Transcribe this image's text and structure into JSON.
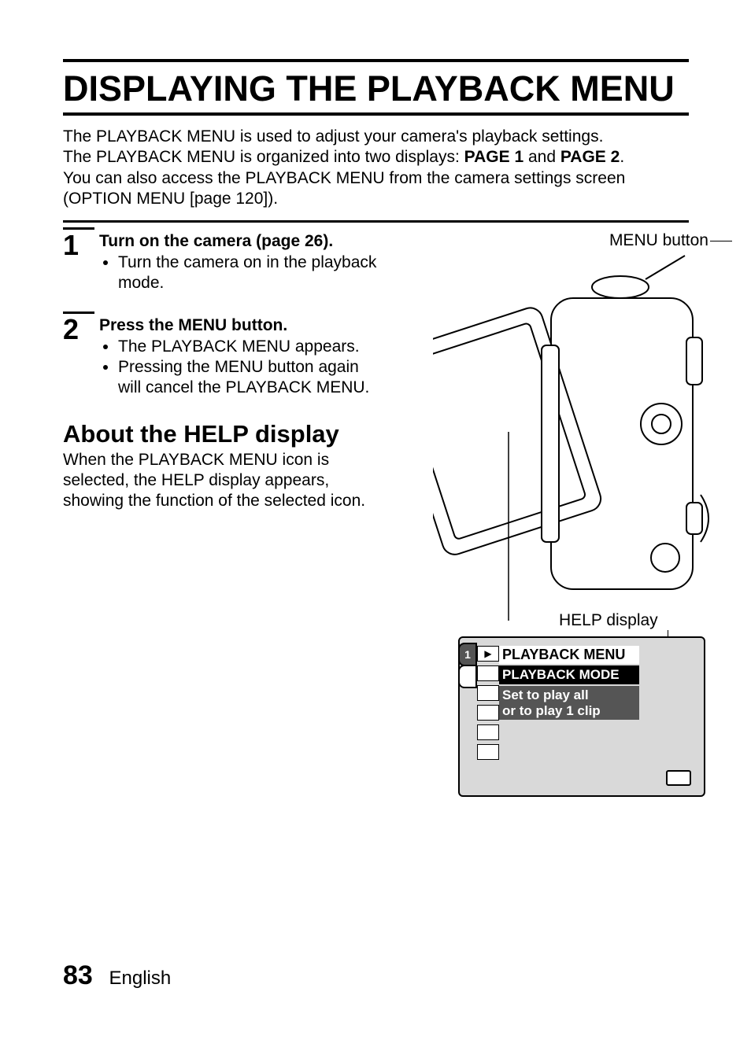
{
  "title": "DISPLAYING THE PLAYBACK MENU",
  "intro": {
    "line1": "The PLAYBACK MENU is used to adjust your camera's playback settings.",
    "line2a": "The PLAYBACK MENU is organized into two displays: ",
    "page1": "PAGE 1",
    "and": " and ",
    "page2": "PAGE 2",
    "line2b": ".",
    "line3": "You can also access the PLAYBACK MENU from the camera settings screen (OPTION MENU [page 120])."
  },
  "steps": [
    {
      "num": "1",
      "head": "Turn on the camera (page 26).",
      "bullets": [
        "Turn the camera on in the playback mode."
      ]
    },
    {
      "num": "2",
      "head": "Press the MENU button.",
      "bullets": [
        "The PLAYBACK MENU appears.",
        "Pressing the MENU button again will cancel the PLAYBACK MENU."
      ]
    }
  ],
  "subhead": "About the HELP display",
  "subtext": "When the PLAYBACK MENU icon is selected, the HELP display appears, showing the function of the selected icon.",
  "figure": {
    "menu_button_label": "MENU button",
    "help_display_label": "HELP display",
    "screen": {
      "title": "PLAYBACK MENU",
      "mode": "PLAYBACK MODE",
      "help_line1": "Set to play all",
      "help_line2": "or to play 1 clip",
      "tab1": "1"
    }
  },
  "footer": {
    "page_number": "83",
    "language": "English"
  }
}
